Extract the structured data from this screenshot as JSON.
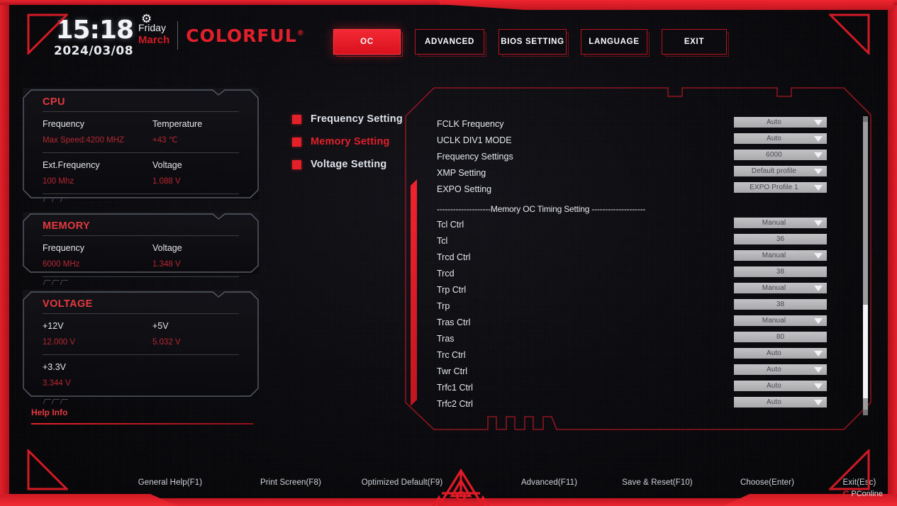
{
  "header": {
    "time": "15:18",
    "date": "2024/03/08",
    "day": "Friday",
    "month": "March",
    "gear_icon": "gear-icon",
    "brand": "COLORFUL",
    "brand_mark": "®"
  },
  "tabs": [
    {
      "label": "OC",
      "active": true
    },
    {
      "label": "ADVANCED",
      "active": false
    },
    {
      "label": "BIOS SETTING",
      "active": false
    },
    {
      "label": "LANGUAGE",
      "active": false
    },
    {
      "label": "EXIT",
      "active": false
    }
  ],
  "info_cards": [
    {
      "title": "CPU",
      "rows": [
        {
          "left_label": "Frequency",
          "left_value": "Max Speed:4200 MHZ",
          "right_label": "Temperature",
          "right_value": "+43 ℃"
        },
        {
          "left_label": "Ext.Frequency",
          "left_value": "100 Mhz",
          "right_label": "Voltage",
          "right_value": "1.088 V"
        }
      ]
    },
    {
      "title": "MEMORY",
      "rows": [
        {
          "left_label": "Frequency",
          "left_value": "6000 MHz",
          "right_label": "Voltage",
          "right_value": "1.348 V"
        }
      ]
    },
    {
      "title": "VOLTAGE",
      "rows": [
        {
          "left_label": "+12V",
          "left_value": "12.000 V",
          "right_label": "+5V",
          "right_value": "5.032 V"
        },
        {
          "left_label": "+3.3V",
          "left_value": "3.344 V",
          "right_label": "",
          "right_value": ""
        }
      ]
    }
  ],
  "help_info": {
    "label": "Help Info",
    "text": ""
  },
  "menu": [
    {
      "label": "Frequency Setting",
      "active": false
    },
    {
      "label": "Memory Setting",
      "active": true
    },
    {
      "label": "Voltage Setting",
      "active": false
    }
  ],
  "settings": [
    {
      "type": "option",
      "label": "FCLK Frequency",
      "value": "Auto",
      "arrow": true
    },
    {
      "type": "option",
      "label": "UCLK DIV1 MODE",
      "value": "Auto",
      "arrow": true
    },
    {
      "type": "option",
      "label": "Frequency Settings",
      "value": "6000",
      "arrow": true
    },
    {
      "type": "option",
      "label": "XMP Setting",
      "value": "Default profile",
      "arrow": true
    },
    {
      "type": "option",
      "label": "EXPO Setting",
      "value": "EXPO Profile 1",
      "arrow": true
    },
    {
      "type": "separator",
      "label": "--------------------Memory OC Timing Setting --------------------"
    },
    {
      "type": "option",
      "label": "Tcl Ctrl",
      "value": "Manual",
      "arrow": true
    },
    {
      "type": "option",
      "label": "Tcl",
      "value": "36",
      "arrow": false
    },
    {
      "type": "option",
      "label": "Trcd Ctrl",
      "value": "Manual",
      "arrow": true
    },
    {
      "type": "option",
      "label": "Trcd",
      "value": "38",
      "arrow": false
    },
    {
      "type": "option",
      "label": "Trp Ctrl",
      "value": "Manual",
      "arrow": true
    },
    {
      "type": "option",
      "label": "Trp",
      "value": "38",
      "arrow": false
    },
    {
      "type": "option",
      "label": "Tras Ctrl",
      "value": "Manual",
      "arrow": true
    },
    {
      "type": "option",
      "label": "Tras",
      "value": "80",
      "arrow": false
    },
    {
      "type": "option",
      "label": "Trc Ctrl",
      "value": "Auto",
      "arrow": true
    },
    {
      "type": "option",
      "label": "Twr Ctrl",
      "value": "Auto",
      "arrow": true
    },
    {
      "type": "option",
      "label": "Trfc1 Ctrl",
      "value": "Auto",
      "arrow": true
    },
    {
      "type": "option",
      "label": "Trfc2 Ctrl",
      "value": "Auto",
      "arrow": true
    }
  ],
  "footer_keys": [
    "General Help(F1)",
    "Print Screen(F8)",
    "Optimized Default(F9)",
    "Advanced(F11)",
    "Save & Reset(F10)",
    "Choose(Enter)",
    "Exit(Esc)"
  ],
  "watermark": {
    "mark": "C",
    "text": "PConline"
  },
  "colors": {
    "accent_red": "#e2202c",
    "bright_red": "#f32a35",
    "value_red": "#b52730",
    "text_light": "#e6e9ee",
    "control_gray": "#b9b9bc",
    "background": "#07070a"
  }
}
